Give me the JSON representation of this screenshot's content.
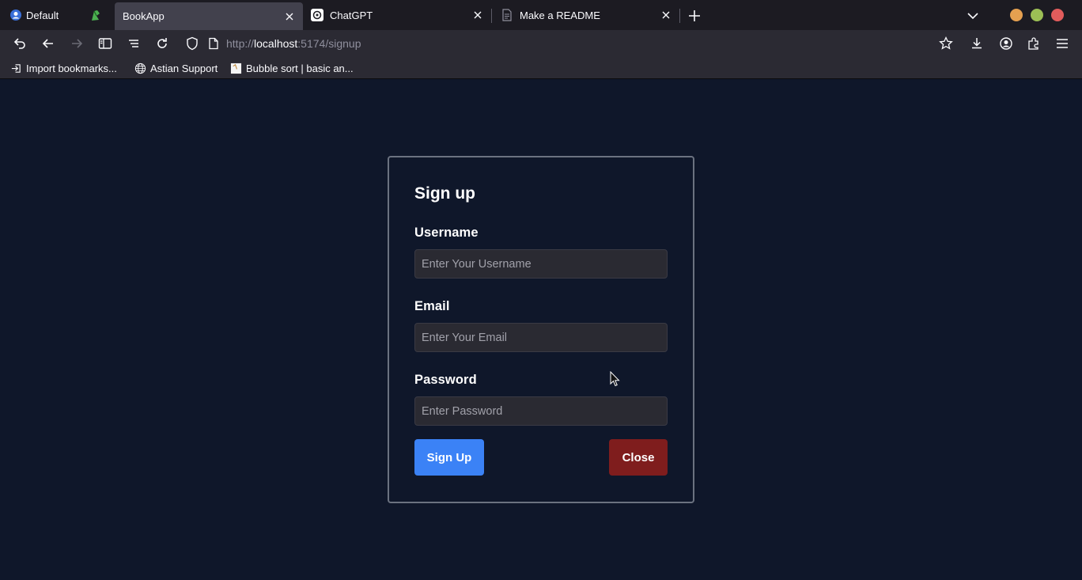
{
  "browser": {
    "tabs": [
      {
        "label": "Default",
        "favicon": "default-profile-icon"
      },
      {
        "label": "BookApp",
        "favicon": "none",
        "active": true
      },
      {
        "label": "ChatGPT",
        "favicon": "chatgpt-icon"
      },
      {
        "label": "Make a README",
        "favicon": "document-icon"
      }
    ],
    "url": {
      "scheme": "http://",
      "host": "localhost",
      "rest": ":5174/signup"
    },
    "bookmarks": [
      {
        "label": "Import bookmarks...",
        "icon": "import-icon"
      },
      {
        "label": "Astian Support",
        "icon": "globe-icon"
      },
      {
        "label": "Bubble sort | basic an...",
        "icon": "page-thumbnail-icon"
      }
    ],
    "window_controls": {
      "minimize_color": "#e5a050",
      "maximize_color": "#9cbf55",
      "close_color": "#e25c5c"
    }
  },
  "signup": {
    "title": "Sign up",
    "username": {
      "label": "Username",
      "placeholder": "Enter Your Username",
      "value": ""
    },
    "email": {
      "label": "Email",
      "placeholder": "Enter Your Email",
      "value": ""
    },
    "password": {
      "label": "Password",
      "placeholder": "Enter Password",
      "value": ""
    },
    "submit_label": "Sign Up",
    "close_label": "Close"
  },
  "colors": {
    "page_background": "#0f172a",
    "primary_button": "#3b82f6",
    "close_button": "#7f1d1d"
  }
}
